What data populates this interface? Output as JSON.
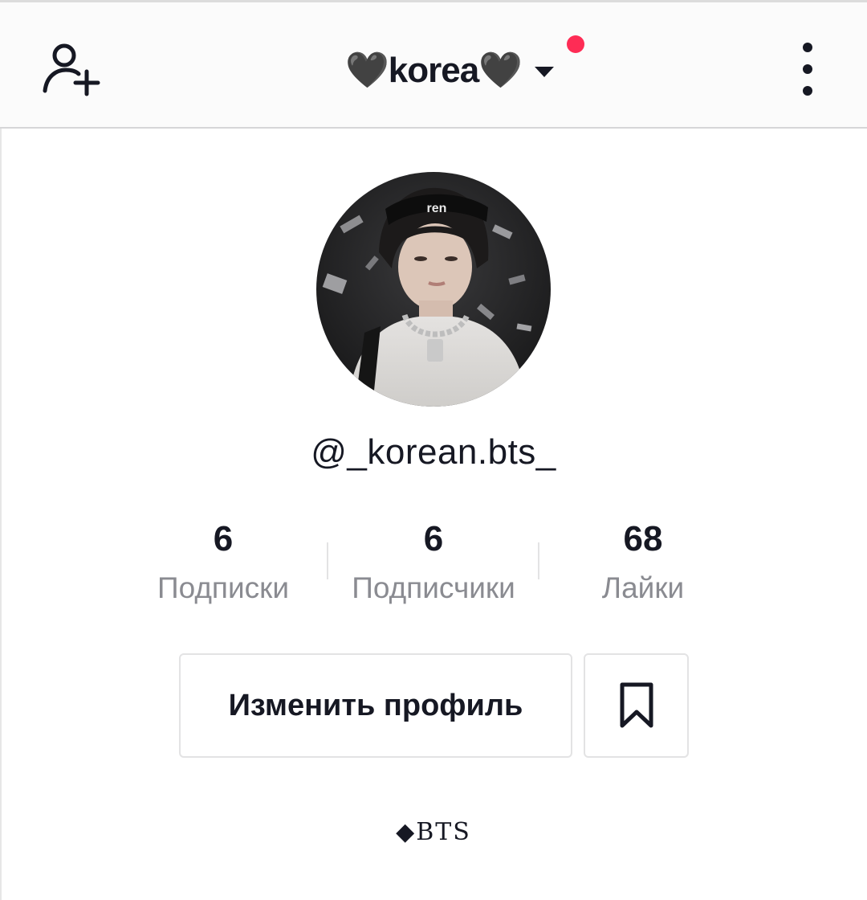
{
  "header": {
    "account_name": "🖤korea🖤",
    "has_notification": true,
    "notification_color": "#fe2c55",
    "icons": {
      "left": "add-user-icon",
      "switcher": "caret-down-icon",
      "right": "more-vertical-icon"
    }
  },
  "profile": {
    "username": "@_korean.bts_",
    "bio": "◆BTS"
  },
  "stats": [
    {
      "value": "6",
      "label": "Подписки"
    },
    {
      "value": "6",
      "label": "Подписчики"
    },
    {
      "value": "68",
      "label": "Лайки"
    }
  ],
  "actions": {
    "edit_profile_label": "Изменить профиль",
    "bookmark_icon": "bookmark-icon"
  },
  "colors": {
    "text_primary": "#161823",
    "text_secondary": "#8a8b91",
    "border": "#e3e3e4"
  }
}
